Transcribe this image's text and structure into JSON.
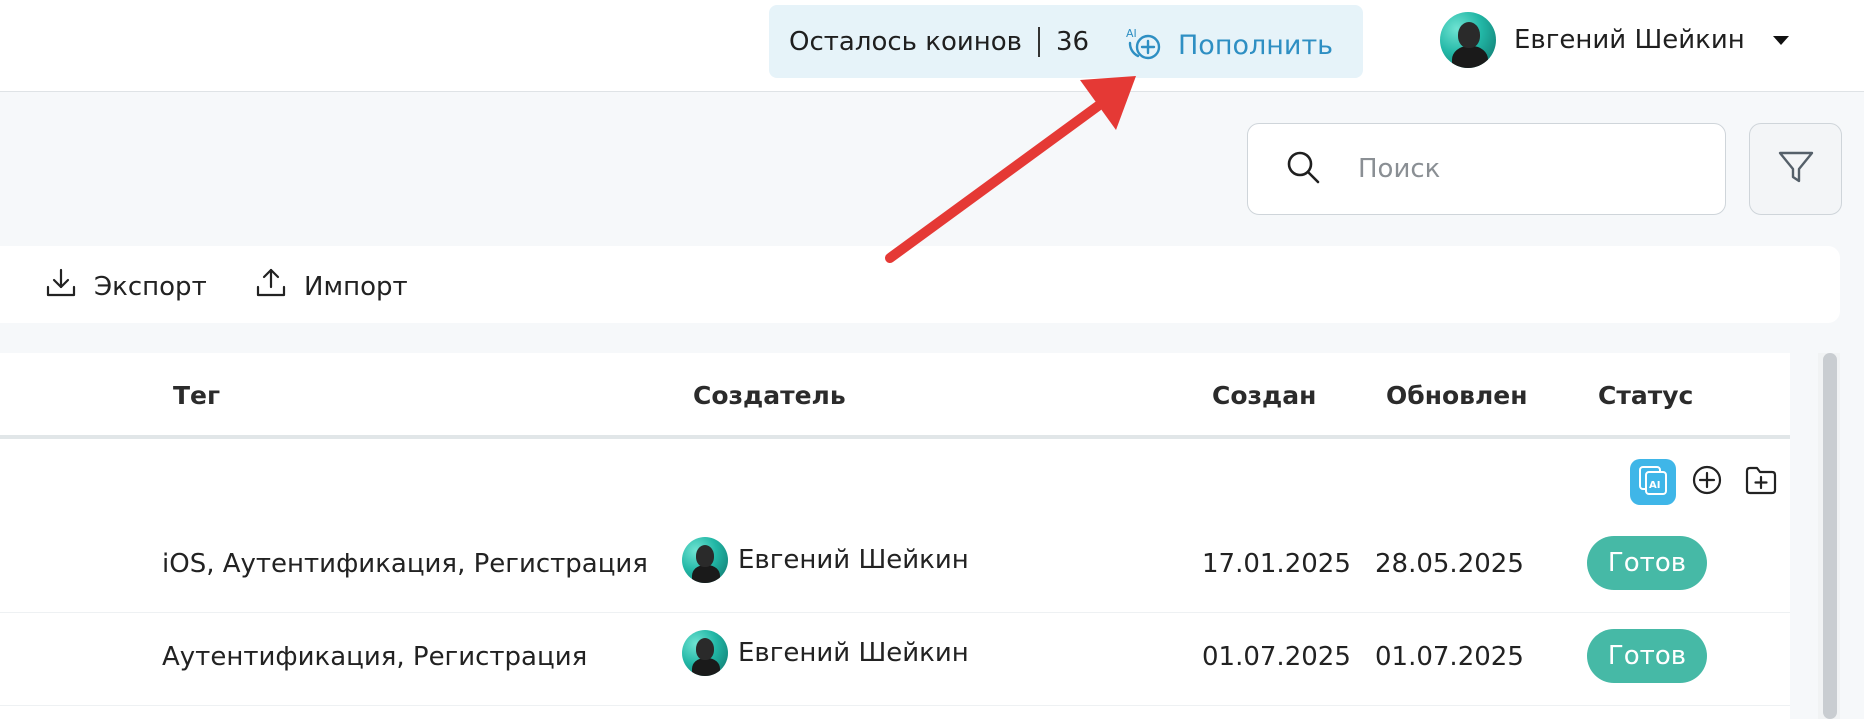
{
  "header": {
    "coins_label": "Осталось коинов",
    "coins_count": "36",
    "topup_label": "Пополнить",
    "user_name": "Евгений Шейкин"
  },
  "search": {
    "placeholder": "Поиск"
  },
  "toolbar": {
    "export_label": "Экспорт",
    "import_label": "Импорт"
  },
  "table": {
    "columns": [
      "Тег",
      "Создатель",
      "Создан",
      "Обновлен",
      "Статус"
    ],
    "rows": [
      {
        "tag": "iOS, Аутентификация, Регистрация",
        "creator": "Евгений Шейкин",
        "created": "17.01.2025",
        "updated": "28.05.2025",
        "status": "Готов"
      },
      {
        "tag": "Аутентификация, Регистрация",
        "creator": "Евгений Шейкин",
        "created": "01.07.2025",
        "updated": "01.07.2025",
        "status": "Готов"
      }
    ]
  },
  "icons": {
    "topup": "ai-coin-plus-icon",
    "search": "search-icon",
    "filter": "filter-icon",
    "export": "download-icon",
    "import": "upload-icon",
    "ai_action": "ai-copy-icon",
    "add": "plus-circle-icon",
    "add_folder": "folder-plus-icon",
    "caret": "caret-down-icon"
  },
  "colors": {
    "accent": "#2e8fc3",
    "coins_bg": "#e6f3f9",
    "status_ready": "#46b9a6",
    "ai_button": "#3fb6e8",
    "annotation_arrow": "#e53935"
  }
}
